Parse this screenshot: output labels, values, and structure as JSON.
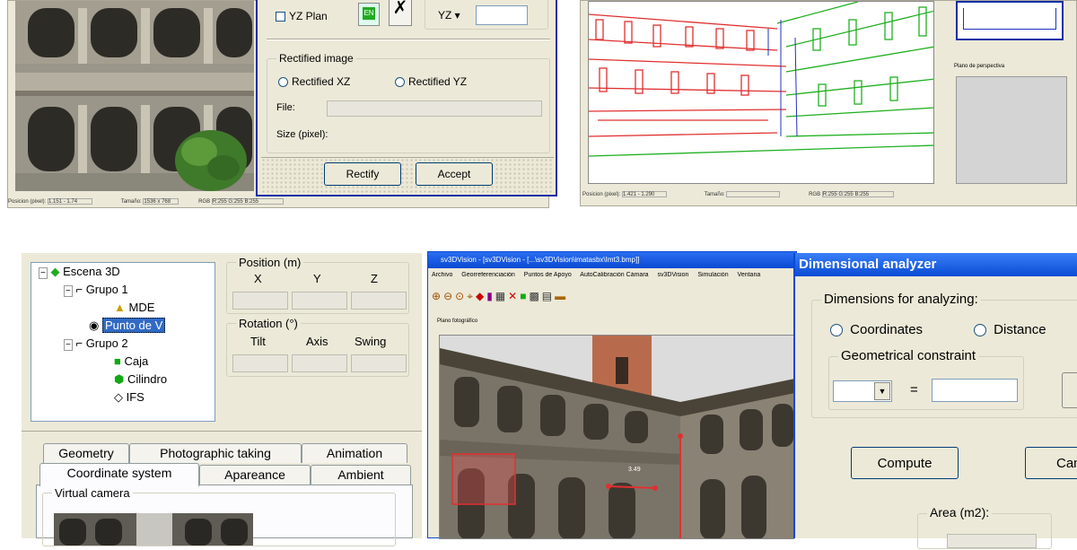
{
  "panel_rectify": {
    "yz_plan_label": "YZ Plan",
    "yz_label": "YZ ▾",
    "yz_value": "",
    "rectified_group_title": "Rectified image",
    "rectified_xz_label": "Rectified XZ",
    "rectified_yz_label": "Rectified YZ",
    "file_label": "File:",
    "file_value": "",
    "size_label": "Size (pixel):",
    "rectify_button": "Rectify",
    "accept_button": "Accept",
    "status_left_a": "Posicion (pixel):",
    "status_left_b": "1.151 - 1.74",
    "status_left_c": "Tamaño:",
    "status_left_d": "1536 x 768",
    "status_left_e": "RGB",
    "status_left_f": "R:255 G:255 B:255"
  },
  "panel_vector": {
    "perspective_label": "Plano de perspectiva",
    "status_a": "Posicion (pixel):",
    "status_b": "1.421 - 1.290",
    "status_c": "Tamaño:",
    "status_d": "RGB",
    "status_e": "R:255 G:255 B:255"
  },
  "panel_scene": {
    "tree": [
      "Escena 3D",
      "Grupo 1",
      "MDE",
      "Punto de V",
      "Grupo 2",
      "Caja",
      "Cilindro",
      "IFS"
    ],
    "position_title": "Position (m)",
    "pos_x": "X",
    "pos_y": "Y",
    "pos_z": "Z",
    "rotation_title": "Rotation (°)",
    "rot_tilt": "Tilt",
    "rot_axis": "Axis",
    "rot_swing": "Swing",
    "tabs_row1": [
      "Geometry",
      "Photographic taking",
      "Animation"
    ],
    "tabs_row2": [
      "Coordinate system",
      "Apareance",
      "Ambient"
    ],
    "virtual_camera_title": "Virtual camera"
  },
  "panel_app": {
    "title": "sv3DVision - [sv3DVision - [...\\sv3DVision\\imatasbx\\Imt3.bmp]]",
    "menu": [
      "Archivo",
      "Georreferenciación",
      "Puntos de Apoyo",
      "AutoCalibración Cámara",
      "sv3DVision",
      "Simulación",
      "Ventana"
    ],
    "canvas_label": "Plano fotográfico",
    "measure_label": "3.49"
  },
  "panel_dimensional": {
    "title": "Dimensional analyzer",
    "group_title": "Dimensions for analyzing:",
    "coord_label": "Coordinates",
    "distance_label": "Distance",
    "constraint_title": "Geometrical constraint",
    "equals": "=",
    "compute_button": "Compute",
    "cancel_button": "Can",
    "area_label": "Area (m2):"
  },
  "colors": {
    "xp_title": "#0a4ad4",
    "window_bg": "#ece9d8",
    "select_blue": "#316ac5",
    "lines_red": "#e03030",
    "lines_green": "#20b020"
  }
}
